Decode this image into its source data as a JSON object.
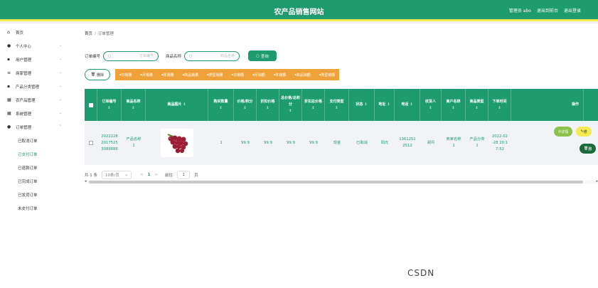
{
  "header": {
    "title": "农产品销售网站",
    "admin_label": "管理员 abo",
    "backend_link": "退出到前台",
    "logout_link": "退出登录"
  },
  "sidebar": {
    "items": [
      {
        "icon": "home-icon",
        "glyph": "⌂",
        "label": "首页"
      },
      {
        "icon": "user-icon",
        "glyph": "👤",
        "label": "个人中心"
      },
      {
        "icon": "users-icon",
        "glyph": "▦",
        "label": "用户管理"
      },
      {
        "icon": "merchant-icon",
        "glyph": "≡",
        "label": "商家管理"
      },
      {
        "icon": "category-icon",
        "glyph": "▤",
        "label": "产品分类管理"
      },
      {
        "icon": "product-icon",
        "glyph": "▦",
        "label": "农产品管理"
      },
      {
        "icon": "system-icon",
        "glyph": "▦",
        "label": "系统管理"
      },
      {
        "icon": "order-icon",
        "glyph": "👤",
        "label": "订单管理"
      }
    ],
    "subitems": [
      "已取消订单",
      "已支付订单",
      "已退款订单",
      "已完成订单",
      "已发货订单",
      "未支付订单"
    ]
  },
  "breadcrumb": {
    "home": "首页",
    "sep": "/",
    "current": "订单管理"
  },
  "search": {
    "order_label": "订单编号",
    "order_placeholder": "订单编号",
    "product_label": "商品名称",
    "product_placeholder": "商品名称",
    "query_button": "查询"
  },
  "actions": {
    "delete_button": "删除",
    "stat_buttons": [
      "日销量",
      "月销量",
      "年销量",
      "商品销量",
      "类型销量",
      "日销额",
      "月销额",
      "年销额",
      "商品销额",
      "类型销额"
    ]
  },
  "table": {
    "headers": [
      "订单编号",
      "商品名称",
      "商品图片",
      "购买数量",
      "价格/积分",
      "折扣价格",
      "总价格/总积分",
      "折扣总价格",
      "支付类型",
      "状态",
      "地址",
      "电话",
      "收货人",
      "商户名称",
      "商品类型",
      "下单时间",
      "操作"
    ],
    "row": {
      "order_no": "20222282017525 3088888",
      "order_no_l1": "2022228",
      "order_no_l2": "2017525",
      "order_no_l3": "3088888",
      "product_name_l1": "产品名称",
      "product_name_l2": "1",
      "quantity": "1",
      "price": "99.9",
      "discount_price": "99.9",
      "total_price": "99.9",
      "discount_total": "99.9",
      "pay_type": "现金",
      "status": "已取消",
      "address": "阳光",
      "phone_l1": "1361251",
      "phone_l2": "2512",
      "receiver": "胡月",
      "merchant_l1": "商家名称",
      "merchant_l2": "1",
      "product_type_l1": "产品分类",
      "product_type_l2": "1",
      "time_l1": "2022-02",
      "time_l2": "-28 20:1",
      "time_l3": "7:52",
      "op_detail": "详情",
      "op_edit": "修",
      "op_delete": "删"
    }
  },
  "pager": {
    "total": "共 1 条",
    "page_size": "10条/页",
    "prev": "<",
    "current": "1",
    "next": ">",
    "goto_label": "前往",
    "goto_value": "1",
    "page_unit": "页"
  },
  "watermark": "CSDN"
}
